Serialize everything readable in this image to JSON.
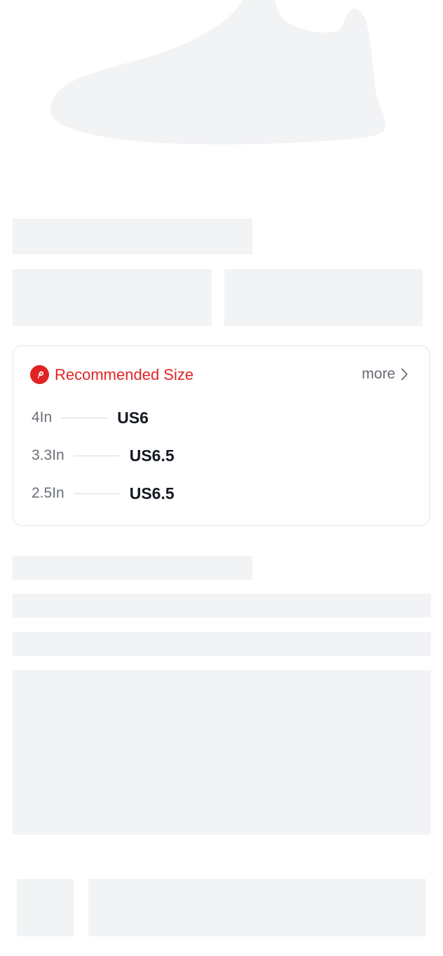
{
  "product": {
    "image_icon": "sneaker-placeholder-icon"
  },
  "recommended": {
    "icon": "location-pin-icon",
    "title": "Recommended Size",
    "more_label": "more",
    "more_icon": "chevron-right-icon",
    "rows": [
      {
        "measure": "4In",
        "size": "US6"
      },
      {
        "measure": "3.3In",
        "size": "US6.5"
      },
      {
        "measure": "2.5In",
        "size": "US6.5"
      }
    ]
  },
  "colors": {
    "accent": "#e02424",
    "skeleton": "#f2f3f5",
    "border": "#e3e5e8",
    "muted_text": "#6a6f77",
    "strong_text": "#141821"
  }
}
